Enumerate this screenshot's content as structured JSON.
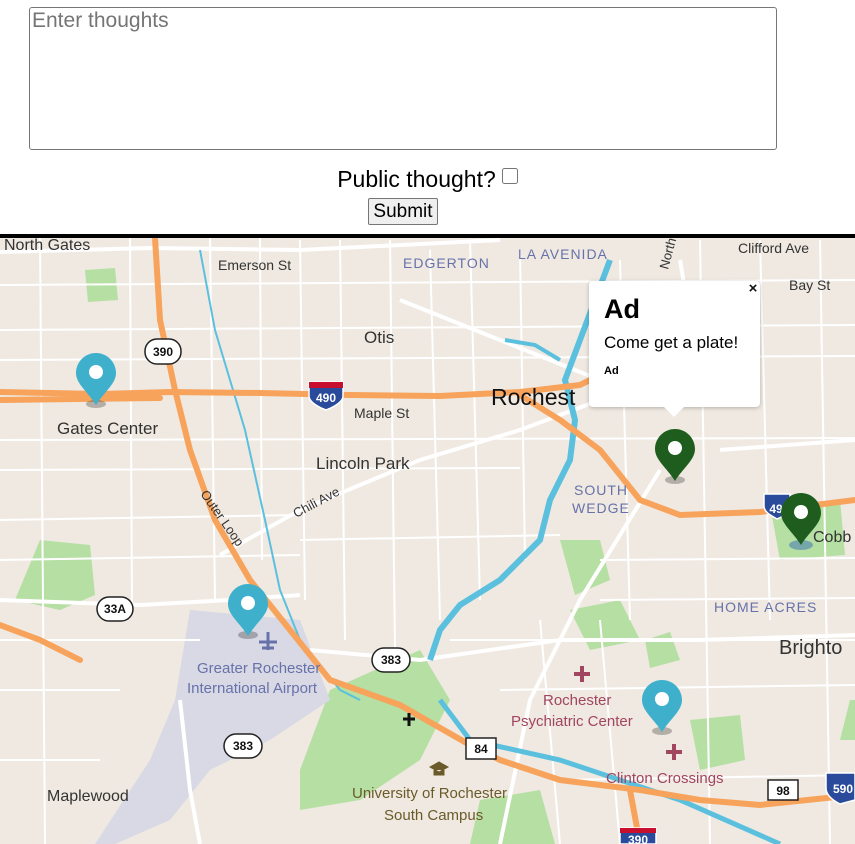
{
  "form": {
    "placeholder": "Enter thoughts",
    "public_label": "Public thought?",
    "public_checked": false,
    "submit_label": "Submit"
  },
  "popup": {
    "title": "Ad",
    "body": "Come get a plate!",
    "small": "Ad",
    "close": "×"
  },
  "map": {
    "labels": {
      "north_gates": "North Gates",
      "emerson": "Emerson St",
      "edgerton": "EDGERTON",
      "la_avenida": "LA AVENIDA",
      "north": "North",
      "clifford": "Clifford Ave",
      "bay": "Bay St",
      "otis": "Otis",
      "rochester": "Rochest",
      "gates_center": "Gates Center",
      "maple": "Maple St",
      "lincoln_park": "Lincoln Park",
      "chili": "Chili Ave",
      "outer_loop": "Outer Loop",
      "south": "SOUTH",
      "wedge": "WEDGE",
      "cobb": "Cobb",
      "home_acres": "HOME ACRES",
      "brighton": "Brighto",
      "airport_1": "Greater Rochester",
      "airport_2": "International Airport",
      "psych_1": "Rochester",
      "psych_2": "Psychiatric Center",
      "clinton": "Clinton Crossings",
      "maplewood": "Maplewood",
      "uofr_1": "University of Rochester",
      "uofr_2": "South Campus"
    },
    "shields": {
      "r390": "390",
      "i490": "490",
      "r33a": "33A",
      "r383a": "383",
      "r383b": "383",
      "r84": "84",
      "r98": "98",
      "i590": "590",
      "i490b": "49",
      "i390": "390"
    },
    "colors": {
      "background": "#efe9e1",
      "highway": "#f7a35c",
      "water": "#5bc0de",
      "park": "#b5dfa3",
      "pin_blue": "#3eb0cc",
      "pin_green": "#1f5d1f",
      "label_blue": "#6772aa",
      "label_pink": "#a14560"
    },
    "markers": [
      "pin-blue",
      "pin-blue",
      "pin-green",
      "pin-green",
      "pin-blue"
    ]
  }
}
